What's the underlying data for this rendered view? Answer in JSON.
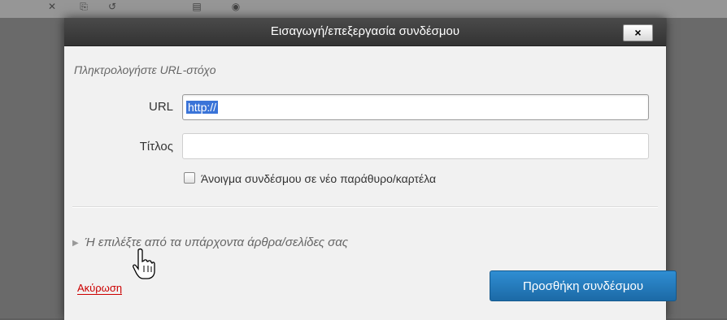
{
  "dialog": {
    "title": "Εισαγωγή/επεξεργασία συνδέσμου",
    "close_label": "×",
    "prompt": "Πληκτρολογήστε URL-στόχο",
    "url_label": "URL",
    "url_value": "http://",
    "title_label": "Τίτλος",
    "title_value": "",
    "new_window_label": "Άνοιγμα συνδέσμου σε νέο παράθυρο/καρτέλα",
    "new_window_checked": false,
    "existing_toggle_label": "Ή επιλέξτε από τα υπάρχοντα άρθρα/σελίδες σας",
    "cancel_label": "Ακύρωση",
    "submit_label": "Προσθήκη συνδέσμου"
  },
  "colors": {
    "titlebar": "#3a3a3a",
    "primary": "#2478bd",
    "cancel": "#cc0000",
    "selection": "#3a74d8"
  },
  "icons": {
    "toolbar": [
      "close-x-icon",
      "link-icon",
      "undo-icon",
      "document-icon",
      "help-icon"
    ],
    "cursor": "hand-pointer-icon"
  }
}
